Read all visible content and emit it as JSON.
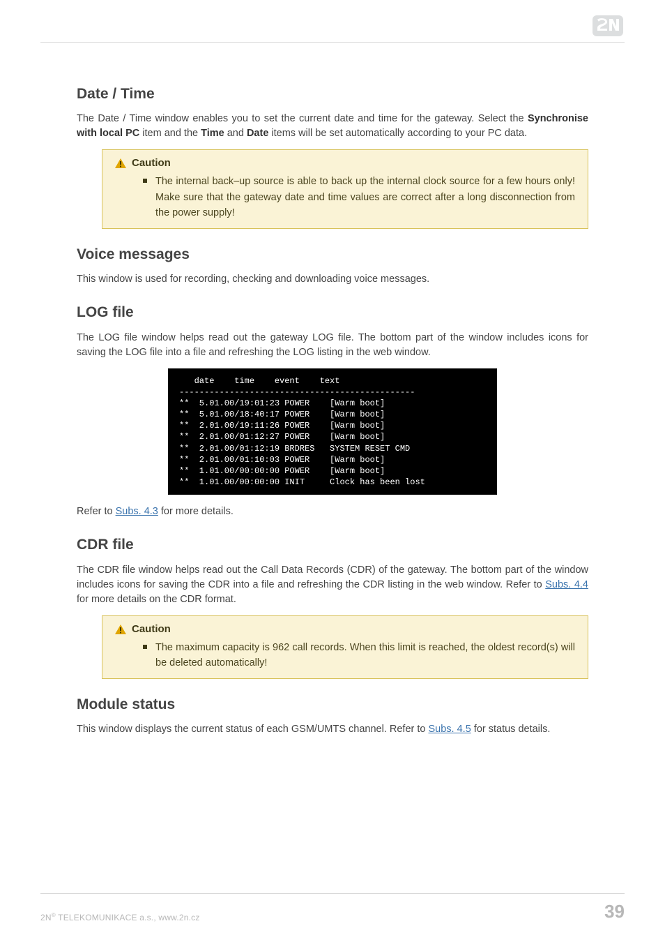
{
  "sections": {
    "date_time": {
      "heading": "Date / Time",
      "para_pre": "The Date / Time window enables you to set the current date and time for the gateway. Select the ",
      "para_bold1": "Synchronise with local PC",
      "para_mid1": " item and the ",
      "para_bold2": "Time",
      "para_mid2": " and ",
      "para_bold3": "Date",
      "para_post": " items will be set automatically according to your PC data.",
      "caution": {
        "title": "Caution",
        "body": "The internal back–up source is able to back up the internal clock source for a few hours only! Make sure that the gateway date and time values are correct after a long disconnection from the power supply!"
      }
    },
    "voice_messages": {
      "heading": "Voice messages",
      "para": "This window is used for recording, checking and downloading voice messages."
    },
    "log_file": {
      "heading": "LOG file",
      "para": "The LOG file window helps read out the gateway LOG file. The bottom part of the window includes icons for saving the LOG file into a file and refreshing the LOG listing in the web window.",
      "terminal": "   date    time    event    text\n-----------------------------------------------\n**  5.01.00/19:01:23 POWER    [Warm boot]\n**  5.01.00/18:40:17 POWER    [Warm boot]\n**  2.01.00/19:11:26 POWER    [Warm boot]\n**  2.01.00/01:12:27 POWER    [Warm boot]\n**  2.01.00/01:12:19 BRDRES   SYSTEM RESET CMD\n**  2.01.00/01:10:03 POWER    [Warm boot]\n**  1.01.00/00:00:00 POWER    [Warm boot]\n**  1.01.00/00:00:00 INIT     Clock has been lost",
      "refer_pre": "Refer to ",
      "refer_link": "Subs. 4.3",
      "refer_post": " for more details."
    },
    "cdr_file": {
      "heading": "CDR file",
      "para_pre": "The CDR file window helps read out the Call Data Records (CDR) of the gateway. The bottom part of the window includes icons for saving the CDR into a file and refreshing the CDR listing in the web window. Refer to ",
      "para_link": "Subs. 4.4",
      "para_post": " for more details on the CDR format.",
      "caution": {
        "title": "Caution",
        "body": "The maximum capacity is 962 call records. When this limit is reached, the oldest record(s) will be deleted automatically!"
      }
    },
    "module_status": {
      "heading": "Module status",
      "para_pre": "This window displays the current status of each GSM/UMTS channel. Refer to ",
      "para_link": "Subs. 4.5",
      "para_post": " for status details."
    }
  },
  "footer": {
    "company_pre": "2N",
    "company_reg": "®",
    "company_post": " TELEKOMUNIKACE a.s., www.2n.cz",
    "page": "39"
  }
}
